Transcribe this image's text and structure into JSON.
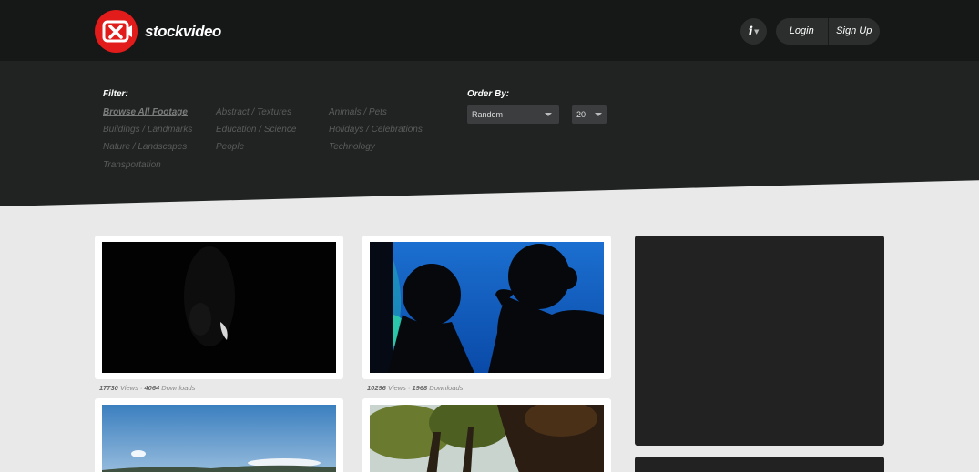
{
  "brand": {
    "name": "stockvideo"
  },
  "header": {
    "info_label": "i",
    "login_label": "Login",
    "signup_label": "Sign Up"
  },
  "filter": {
    "title": "Filter:",
    "items": [
      "Browse All Footage",
      "Abstract / Textures",
      "Animals / Pets",
      "Buildings / Landmarks",
      "Education / Science",
      "Holidays / Celebrations",
      "Nature / Landscapes",
      "People",
      "Technology",
      "Transportation"
    ]
  },
  "order": {
    "title": "Order By:",
    "sort_value": "Random",
    "count_value": "20"
  },
  "videos": [
    {
      "views": "17730",
      "downloads": "4064",
      "views_label": "Views",
      "downloads_label": "Downloads"
    },
    {
      "views": "10296",
      "downloads": "1968",
      "views_label": "Views",
      "downloads_label": "Downloads"
    }
  ],
  "colors": {
    "brand_red": "#e21b1b",
    "header_bg": "#161717",
    "panel_bg": "#212323"
  }
}
